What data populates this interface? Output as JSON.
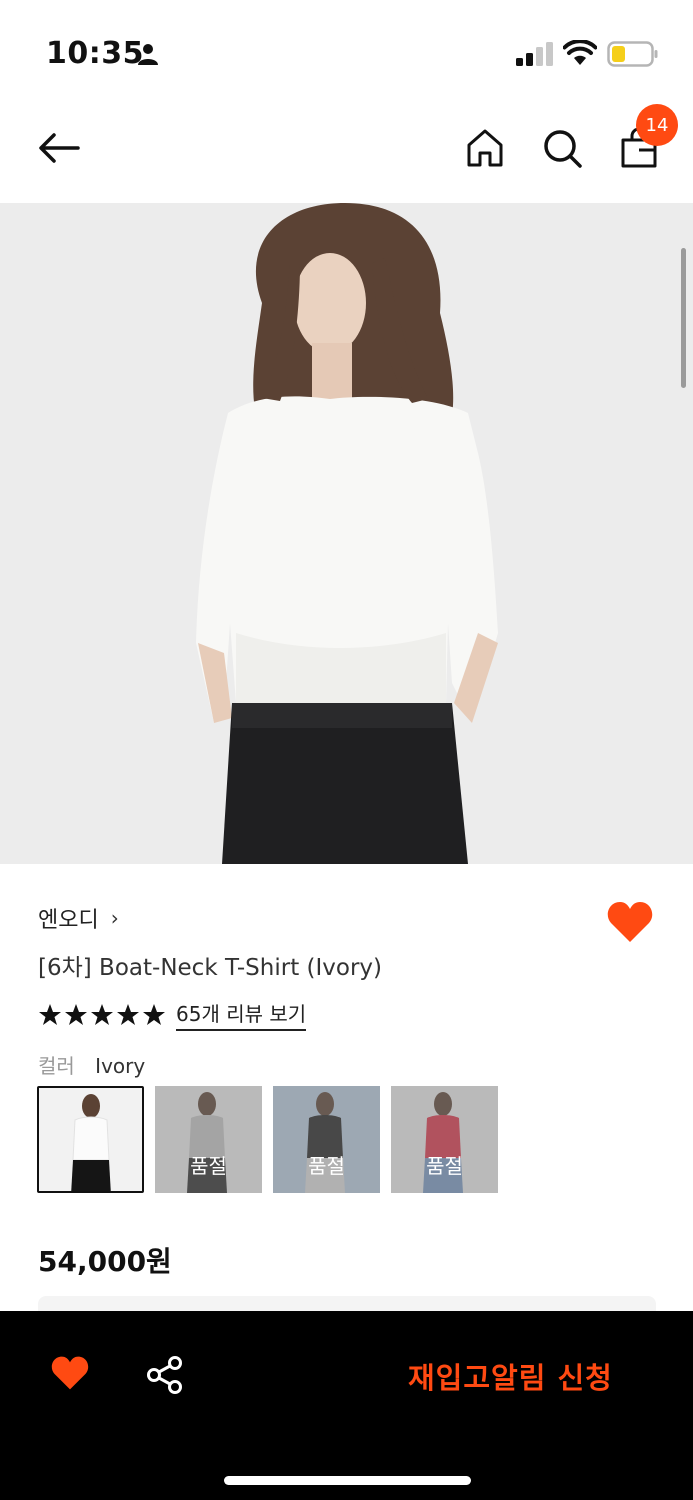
{
  "status_bar": {
    "time": "10:35",
    "icons": [
      "person-icon",
      "signal-icon",
      "wifi-icon",
      "battery-icon"
    ]
  },
  "nav": {
    "icons": [
      "back-arrow-icon",
      "home-icon",
      "search-icon",
      "shopping-bag-icon"
    ],
    "cart_count": "14"
  },
  "product": {
    "brand": "엔오디",
    "brand_chevron": "›",
    "title": "[6차] Boat-Neck T-Shirt (Ivory)",
    "rating_stars": 5,
    "review_link": "65개 리뷰 보기",
    "color_label": "컬러",
    "color_value": "Ivory",
    "swatches": [
      {
        "color": "Ivory",
        "status": ""
      },
      {
        "color": "Gray",
        "status": "품절"
      },
      {
        "color": "Black",
        "status": "품절"
      },
      {
        "color": "Red",
        "status": "품절"
      }
    ],
    "price": "54,000원"
  },
  "bottom_bar": {
    "cta_label": "재입고알림 신청",
    "icons": [
      "heart-icon",
      "share-icon"
    ]
  },
  "colors": {
    "accent": "#ff4a12",
    "bottom_bar_bg": "#000000"
  }
}
